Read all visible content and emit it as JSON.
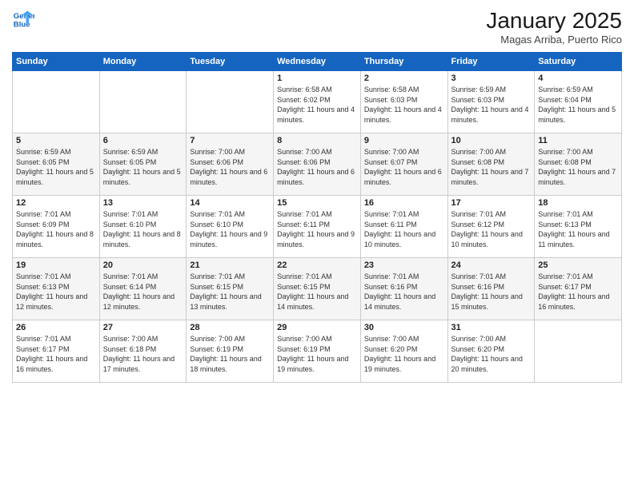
{
  "header": {
    "logo_line1": "General",
    "logo_line2": "Blue",
    "title": "January 2025",
    "location": "Magas Arriba, Puerto Rico"
  },
  "days_of_week": [
    "Sunday",
    "Monday",
    "Tuesday",
    "Wednesday",
    "Thursday",
    "Friday",
    "Saturday"
  ],
  "weeks": [
    [
      {
        "num": "",
        "info": ""
      },
      {
        "num": "",
        "info": ""
      },
      {
        "num": "",
        "info": ""
      },
      {
        "num": "1",
        "info": "Sunrise: 6:58 AM\nSunset: 6:02 PM\nDaylight: 11 hours and 4 minutes."
      },
      {
        "num": "2",
        "info": "Sunrise: 6:58 AM\nSunset: 6:03 PM\nDaylight: 11 hours and 4 minutes."
      },
      {
        "num": "3",
        "info": "Sunrise: 6:59 AM\nSunset: 6:03 PM\nDaylight: 11 hours and 4 minutes."
      },
      {
        "num": "4",
        "info": "Sunrise: 6:59 AM\nSunset: 6:04 PM\nDaylight: 11 hours and 5 minutes."
      }
    ],
    [
      {
        "num": "5",
        "info": "Sunrise: 6:59 AM\nSunset: 6:05 PM\nDaylight: 11 hours and 5 minutes."
      },
      {
        "num": "6",
        "info": "Sunrise: 6:59 AM\nSunset: 6:05 PM\nDaylight: 11 hours and 5 minutes."
      },
      {
        "num": "7",
        "info": "Sunrise: 7:00 AM\nSunset: 6:06 PM\nDaylight: 11 hours and 6 minutes."
      },
      {
        "num": "8",
        "info": "Sunrise: 7:00 AM\nSunset: 6:06 PM\nDaylight: 11 hours and 6 minutes."
      },
      {
        "num": "9",
        "info": "Sunrise: 7:00 AM\nSunset: 6:07 PM\nDaylight: 11 hours and 6 minutes."
      },
      {
        "num": "10",
        "info": "Sunrise: 7:00 AM\nSunset: 6:08 PM\nDaylight: 11 hours and 7 minutes."
      },
      {
        "num": "11",
        "info": "Sunrise: 7:00 AM\nSunset: 6:08 PM\nDaylight: 11 hours and 7 minutes."
      }
    ],
    [
      {
        "num": "12",
        "info": "Sunrise: 7:01 AM\nSunset: 6:09 PM\nDaylight: 11 hours and 8 minutes."
      },
      {
        "num": "13",
        "info": "Sunrise: 7:01 AM\nSunset: 6:10 PM\nDaylight: 11 hours and 8 minutes."
      },
      {
        "num": "14",
        "info": "Sunrise: 7:01 AM\nSunset: 6:10 PM\nDaylight: 11 hours and 9 minutes."
      },
      {
        "num": "15",
        "info": "Sunrise: 7:01 AM\nSunset: 6:11 PM\nDaylight: 11 hours and 9 minutes."
      },
      {
        "num": "16",
        "info": "Sunrise: 7:01 AM\nSunset: 6:11 PM\nDaylight: 11 hours and 10 minutes."
      },
      {
        "num": "17",
        "info": "Sunrise: 7:01 AM\nSunset: 6:12 PM\nDaylight: 11 hours and 10 minutes."
      },
      {
        "num": "18",
        "info": "Sunrise: 7:01 AM\nSunset: 6:13 PM\nDaylight: 11 hours and 11 minutes."
      }
    ],
    [
      {
        "num": "19",
        "info": "Sunrise: 7:01 AM\nSunset: 6:13 PM\nDaylight: 11 hours and 12 minutes."
      },
      {
        "num": "20",
        "info": "Sunrise: 7:01 AM\nSunset: 6:14 PM\nDaylight: 11 hours and 12 minutes."
      },
      {
        "num": "21",
        "info": "Sunrise: 7:01 AM\nSunset: 6:15 PM\nDaylight: 11 hours and 13 minutes."
      },
      {
        "num": "22",
        "info": "Sunrise: 7:01 AM\nSunset: 6:15 PM\nDaylight: 11 hours and 14 minutes."
      },
      {
        "num": "23",
        "info": "Sunrise: 7:01 AM\nSunset: 6:16 PM\nDaylight: 11 hours and 14 minutes."
      },
      {
        "num": "24",
        "info": "Sunrise: 7:01 AM\nSunset: 6:16 PM\nDaylight: 11 hours and 15 minutes."
      },
      {
        "num": "25",
        "info": "Sunrise: 7:01 AM\nSunset: 6:17 PM\nDaylight: 11 hours and 16 minutes."
      }
    ],
    [
      {
        "num": "26",
        "info": "Sunrise: 7:01 AM\nSunset: 6:17 PM\nDaylight: 11 hours and 16 minutes."
      },
      {
        "num": "27",
        "info": "Sunrise: 7:00 AM\nSunset: 6:18 PM\nDaylight: 11 hours and 17 minutes."
      },
      {
        "num": "28",
        "info": "Sunrise: 7:00 AM\nSunset: 6:19 PM\nDaylight: 11 hours and 18 minutes."
      },
      {
        "num": "29",
        "info": "Sunrise: 7:00 AM\nSunset: 6:19 PM\nDaylight: 11 hours and 19 minutes."
      },
      {
        "num": "30",
        "info": "Sunrise: 7:00 AM\nSunset: 6:20 PM\nDaylight: 11 hours and 19 minutes."
      },
      {
        "num": "31",
        "info": "Sunrise: 7:00 AM\nSunset: 6:20 PM\nDaylight: 11 hours and 20 minutes."
      },
      {
        "num": "",
        "info": ""
      }
    ]
  ]
}
